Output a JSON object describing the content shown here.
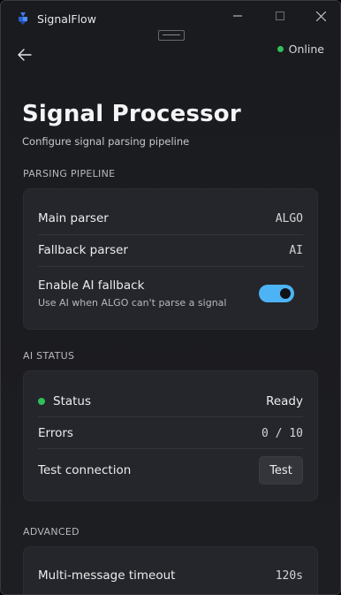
{
  "window": {
    "app_title": "SignalFlow"
  },
  "header": {
    "connection_status": "Online",
    "connection_color": "#2fbf5b"
  },
  "page": {
    "title": "Signal Processor",
    "subtitle": "Configure signal parsing pipeline"
  },
  "sections": {
    "parsing": {
      "label": "PARSING PIPELINE",
      "main_parser_label": "Main parser",
      "main_parser_value": "ALGO",
      "fallback_parser_label": "Fallback parser",
      "fallback_parser_value": "AI",
      "ai_fallback_label": "Enable AI fallback",
      "ai_fallback_help": "Use AI when ALGO can't parse a signal",
      "ai_fallback_enabled": true
    },
    "ai_status": {
      "label": "AI STATUS",
      "status_label": "Status",
      "status_value": "Ready",
      "status_color": "#2fbf5b",
      "errors_label": "Errors",
      "errors_value": "0 / 10",
      "test_label": "Test connection",
      "test_button": "Test"
    },
    "advanced": {
      "label": "ADVANCED",
      "timeout_label": "Multi-message timeout",
      "timeout_value": "120s"
    }
  },
  "colors": {
    "accent": "#4cb4f5",
    "background": "#1b1c20",
    "card": "#25262b"
  }
}
